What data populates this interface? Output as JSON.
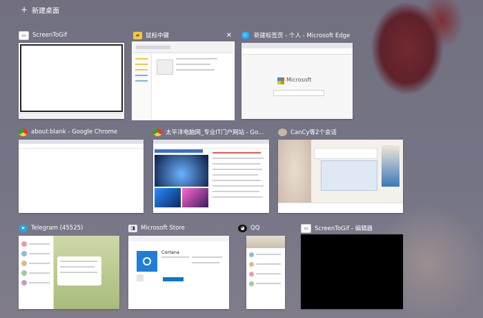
{
  "desktop": {
    "new_desktop_label": "新建桌面",
    "plus_glyph": "+"
  },
  "windows": [
    {
      "title": "ScreenToGif",
      "icon": "screentogif-icon",
      "selected": false
    },
    {
      "title": "鼠标中键",
      "icon": "folder-icon",
      "selected": true,
      "close_glyph": "✕"
    },
    {
      "title": "新建标签页 - 个人 - Microsoft Edge",
      "icon": "edge-icon",
      "selected": false
    },
    {
      "title": "about:blank - Google Chrome",
      "icon": "chrome-icon",
      "selected": false
    },
    {
      "title": "太平洋电脑网_专业IT门户网站 - Go...",
      "icon": "chrome-icon",
      "selected": false
    },
    {
      "title": "CanCy等2个会话",
      "icon": "avatar-icon",
      "selected": false
    },
    {
      "title": "Telegram (45525)",
      "icon": "telegram-icon",
      "selected": false
    },
    {
      "title": "Microsoft Store",
      "icon": "store-icon",
      "selected": false
    },
    {
      "title": "QQ",
      "icon": "qq-icon",
      "selected": false
    },
    {
      "title": "ScreenToGif - 编辑器",
      "icon": "screentogif-icon",
      "selected": false
    }
  ],
  "thumb_text": {
    "edge_brand": "Microsoft",
    "store_app": "Cortana"
  },
  "colors": {
    "accent": "#0a78d4",
    "overlay": "#5a5a70"
  }
}
